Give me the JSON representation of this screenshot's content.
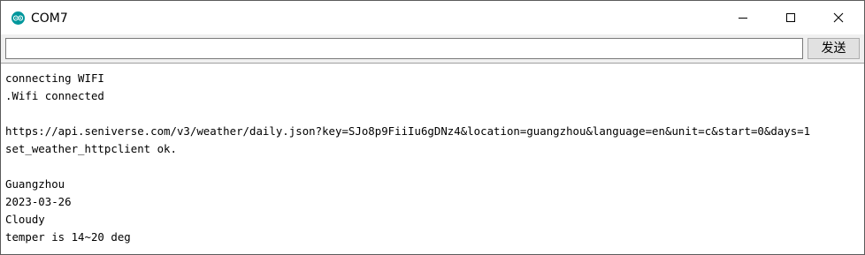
{
  "window": {
    "title": "COM7",
    "app_icon": "arduino-icon",
    "controls": [
      "minimize-icon",
      "maximize-icon",
      "close-icon"
    ]
  },
  "send_bar": {
    "input_value": "",
    "input_placeholder": "",
    "send_label": "发送"
  },
  "output": {
    "lines": [
      "connecting WIFI",
      ".Wifi connected",
      "",
      "https://api.seniverse.com/v3/weather/daily.json?key=SJo8p9FiiIu6gDNz4&location=guangzhou&language=en&unit=c&start=0&days=1",
      "set_weather_httpclient ok.",
      "",
      "Guangzhou",
      "2023-03-26",
      "Cloudy",
      "temper is 14~20 deg"
    ]
  },
  "colors": {
    "title_bg": "#ffffff",
    "chrome_bg": "#f0f0f0",
    "icon_teal": "#00979c"
  }
}
